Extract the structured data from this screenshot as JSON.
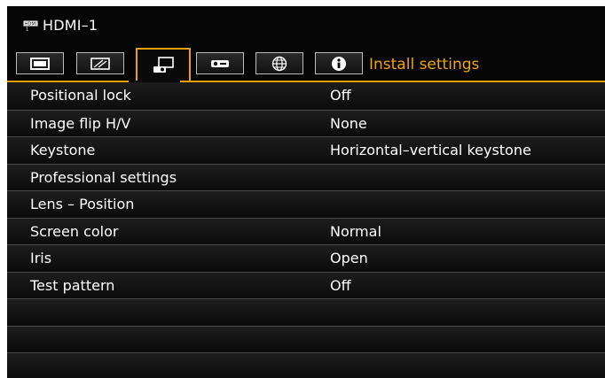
{
  "header": {
    "source_icon": "hdmi-port-icon",
    "source_icon_text": "HDMI 1",
    "source_label": "HDMI–1"
  },
  "tabs": {
    "items": [
      {
        "icon": "picture-monitor-icon",
        "active": false
      },
      {
        "icon": "aspect-screen-icon",
        "active": false
      },
      {
        "icon": "projector-install-icon",
        "active": true
      },
      {
        "icon": "projector-system-icon",
        "active": false
      },
      {
        "icon": "network-globe-icon",
        "active": false
      },
      {
        "icon": "info-icon",
        "active": false
      }
    ],
    "active_title": "Install settings",
    "accent_color": "#f0a500"
  },
  "menu": {
    "rows": [
      {
        "label": "Positional lock",
        "value": "Off"
      },
      {
        "label": "Image flip H/V",
        "value": "None"
      },
      {
        "label": "Keystone",
        "value": "Horizontal–vertical keystone"
      },
      {
        "label": "Professional settings",
        "value": ""
      },
      {
        "label": "Lens – Position",
        "value": ""
      },
      {
        "label": "Screen color",
        "value": "Normal"
      },
      {
        "label": "Iris",
        "value": "Open"
      },
      {
        "label": "Test pattern",
        "value": "Off"
      },
      {
        "label": "",
        "value": ""
      },
      {
        "label": "",
        "value": ""
      },
      {
        "label": "",
        "value": ""
      }
    ]
  }
}
